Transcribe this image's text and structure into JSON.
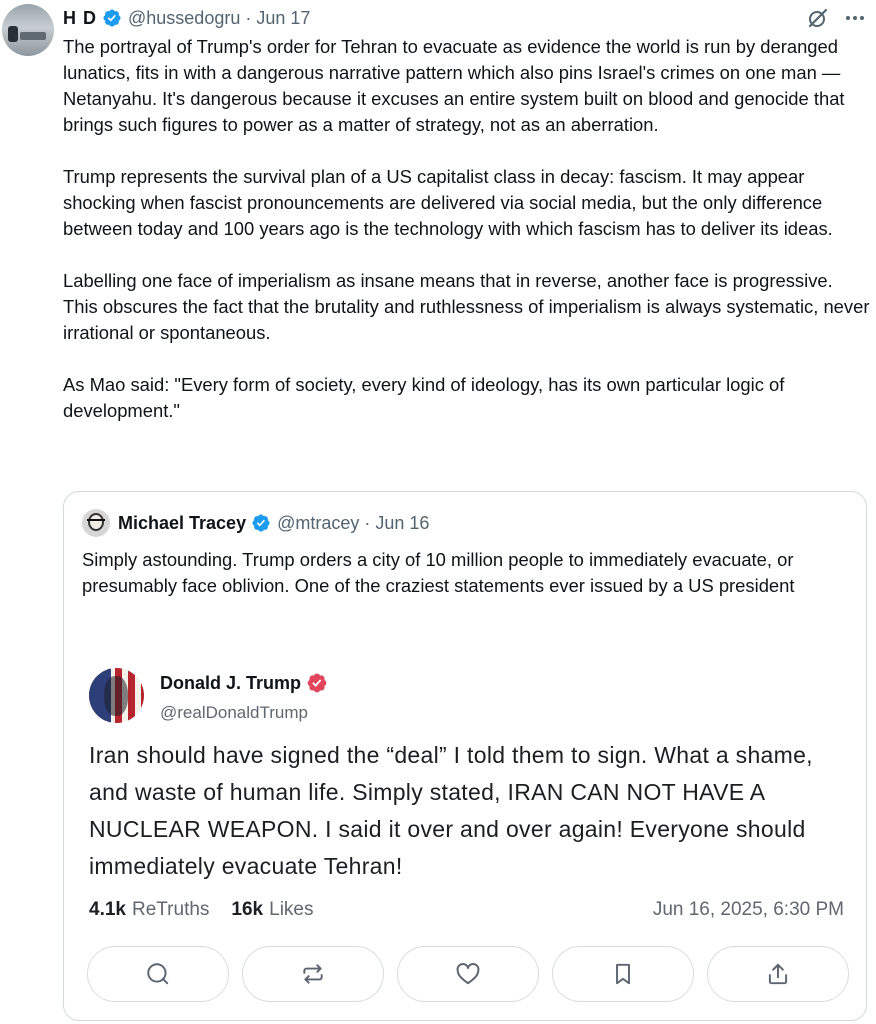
{
  "tweet": {
    "author_name": "H D",
    "handle": "@hussedogru",
    "separator": "·",
    "date": "Jun 17",
    "text": "The portrayal of Trump's order for Tehran to evacuate as evidence the world is run by deranged lunatics, fits in with a dangerous narrative pattern which also pins Israel's crimes on one man — Netanyahu. It's dangerous because it excuses an entire system built on blood and genocide that brings such figures to power as a matter of strategy, not as an aberration.\n\nTrump represents the survival plan of a US capitalist class in decay: fascism. It may appear shocking when fascist pronouncements are delivered via social media, but the only difference between today and 100 years ago is the technology with which fascism has to deliver its ideas.\n\nLabelling one face of imperialism as insane means that in reverse, another face is progressive. This obscures the fact that the brutality and ruthlessness of imperialism is always systematic, never irrational or spontaneous.\n\nAs Mao said: \"Every form of society, every kind of ideology, has its own particular logic of development.\"",
    "icons": {
      "verified": "verified-badge-icon",
      "grok": "grok-icon",
      "more": "more-options-icon"
    },
    "verified_color": "#1d9bf0"
  },
  "quote": {
    "author_name": "Michael Tracey",
    "handle": "@mtracey",
    "separator": "·",
    "date": "Jun 16",
    "text": "Simply astounding. Trump orders a city of 10 million people to immediately evacuate, or presumably face oblivion. One of the craziest statements ever issued by a US president"
  },
  "truth_post": {
    "author_name": "Donald J. Trump",
    "handle": "@realDonaldTrump",
    "verified_color": "#e2455b",
    "text": "Iran should have signed the “deal” I told them to sign. What a shame, and waste of human life. Simply stated, IRAN CAN NOT HAVE A NUCLEAR WEAPON. I said it over and over again! Everyone should immediately evacuate Tehran!",
    "retruths_count": "4.1k",
    "retruths_label": "ReTruths",
    "likes_count": "16k",
    "likes_label": "Likes",
    "timestamp": "Jun 16, 2025, 6:30 PM",
    "actions": [
      "reply-icon",
      "retruth-icon",
      "like-icon",
      "bookmark-icon",
      "share-icon"
    ]
  }
}
